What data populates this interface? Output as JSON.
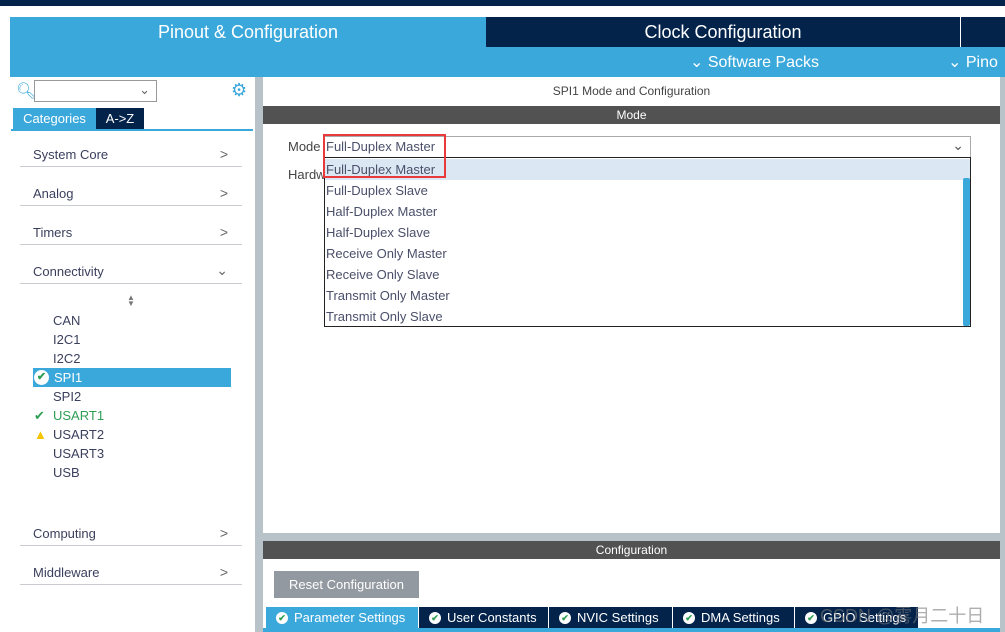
{
  "header": {
    "tabs": [
      {
        "label": "Pinout & Configuration",
        "active": true
      },
      {
        "label": "Clock Configuration",
        "active": false
      }
    ],
    "subnav": [
      {
        "label": "Software Packs",
        "icon": "chevron-down-icon"
      },
      {
        "label": "Pino",
        "icon": "chevron-down-icon"
      }
    ]
  },
  "sidebar": {
    "search_value": "",
    "view_tabs": [
      "Categories",
      "A->Z"
    ],
    "categories": [
      "System Core",
      "Analog",
      "Timers",
      "Connectivity",
      "Computing",
      "Middleware"
    ],
    "connectivity_items": [
      {
        "label": "CAN",
        "status": "none"
      },
      {
        "label": "I2C1",
        "status": "none"
      },
      {
        "label": "I2C2",
        "status": "none"
      },
      {
        "label": "SPI1",
        "status": "ok",
        "selected": true
      },
      {
        "label": "SPI2",
        "status": "none"
      },
      {
        "label": "USART1",
        "status": "ok"
      },
      {
        "label": "USART2",
        "status": "warning"
      },
      {
        "label": "USART3",
        "status": "none"
      },
      {
        "label": "USB",
        "status": "none"
      }
    ]
  },
  "main": {
    "title": "SPI1 Mode and Configuration",
    "mode_header": "Mode",
    "mode_label": "Mode",
    "mode_value": "Full-Duplex Master",
    "hardware_label": "Hardw",
    "mode_options": [
      "Full-Duplex Master",
      "Full-Duplex Slave",
      "Half-Duplex Master",
      "Half-Duplex Slave",
      "Receive Only Master",
      "Receive Only Slave",
      "Transmit Only Master",
      "Transmit Only Slave"
    ],
    "config_header": "Configuration",
    "reset_button": "Reset Configuration",
    "config_tabs": [
      "Parameter Settings",
      "User Constants",
      "NVIC Settings",
      "DMA Settings",
      "GPIO Settings"
    ]
  },
  "watermark": "CSDN @雾月二十日",
  "colors": {
    "accent": "#3ba8db",
    "navy": "#03234b",
    "header_gray": "#525252",
    "highlight": "#dbe8f4",
    "ok": "#2e9e55",
    "warning": "#f5c400",
    "red_box": "#e83a3a"
  }
}
